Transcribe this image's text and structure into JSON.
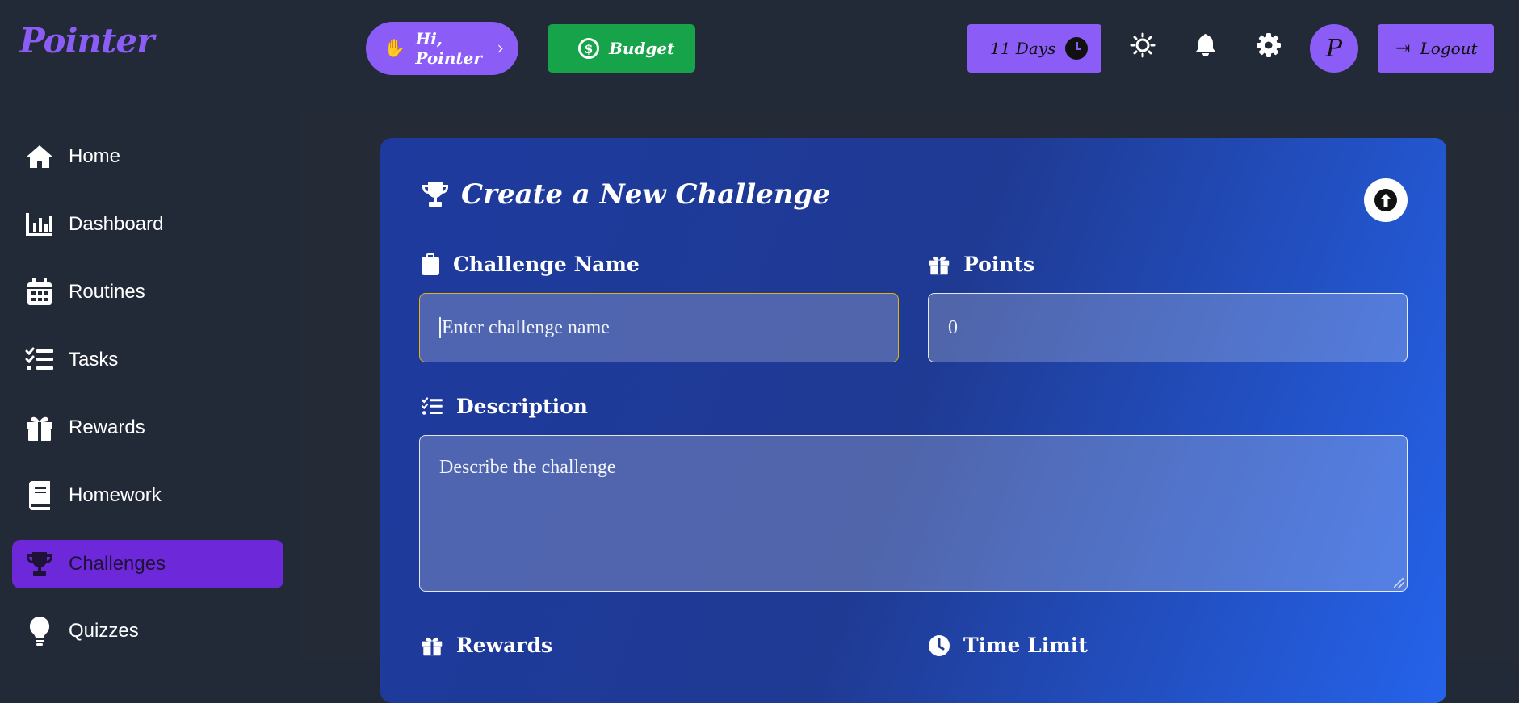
{
  "app": {
    "logo": "Pointer"
  },
  "header": {
    "greeting": "Hi, Pointer",
    "budget_label": "Budget",
    "days_label": "11 Days",
    "avatar_initial": "P",
    "logout_label": "Logout"
  },
  "sidebar": {
    "items": [
      {
        "label": "Home",
        "icon": "home-icon"
      },
      {
        "label": "Dashboard",
        "icon": "chart-icon"
      },
      {
        "label": "Routines",
        "icon": "calendar-icon"
      },
      {
        "label": "Tasks",
        "icon": "list-check-icon"
      },
      {
        "label": "Rewards",
        "icon": "gift-icon"
      },
      {
        "label": "Homework",
        "icon": "book-icon"
      },
      {
        "label": "Challenges",
        "icon": "trophy-icon",
        "active": true
      },
      {
        "label": "Quizzes",
        "icon": "lightbulb-icon"
      }
    ]
  },
  "form": {
    "title": "Create a New Challenge",
    "name_label": "Challenge Name",
    "name_placeholder": "Enter challenge name",
    "points_label": "Points",
    "points_value": "0",
    "description_label": "Description",
    "description_placeholder": "Describe the challenge",
    "rewards_label": "Rewards",
    "time_limit_label": "Time Limit"
  },
  "colors": {
    "accent": "#8b5cf6",
    "budget": "#16a34a",
    "active_nav": "#6d28d9",
    "background": "#222a37"
  }
}
